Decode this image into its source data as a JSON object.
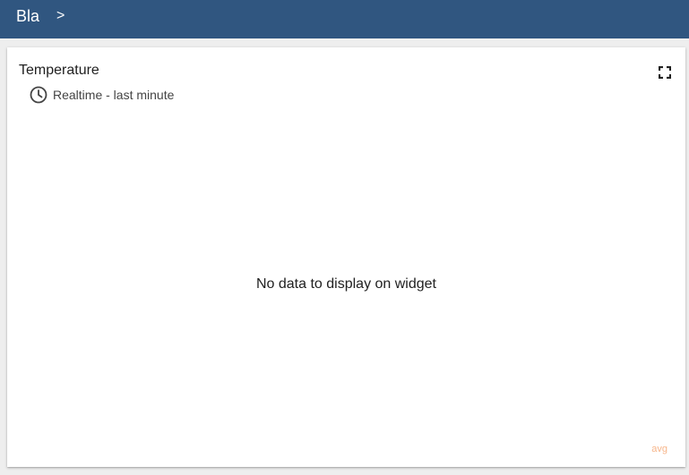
{
  "header": {
    "breadcrumb_root": "Bla",
    "breadcrumb_separator": ">",
    "background_color": "#305680"
  },
  "widget": {
    "title": "Temperature",
    "timewindow_label": "Realtime - last minute",
    "no_data_message": "No data to display on widget",
    "legend_label": "avg",
    "fullscreen_icon": "fullscreen-icon",
    "clock_icon": "clock-icon"
  }
}
